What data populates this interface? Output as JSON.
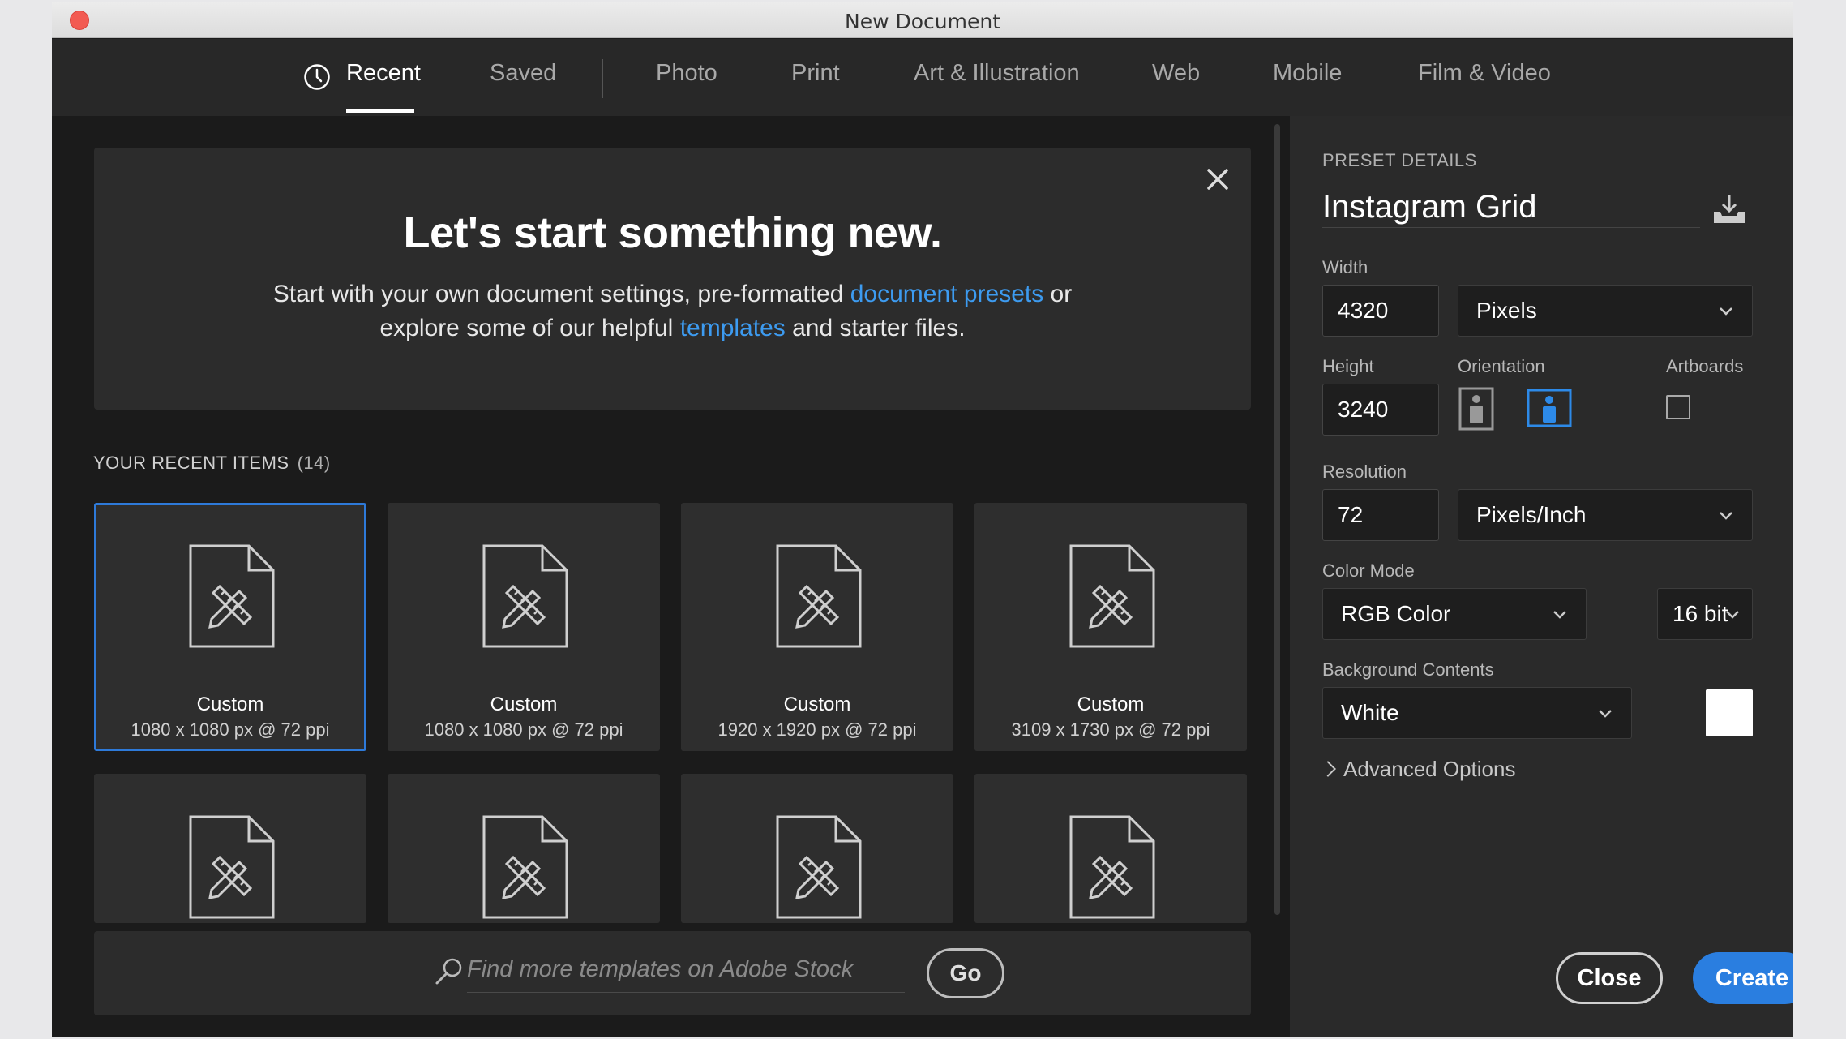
{
  "window": {
    "title": "New Document"
  },
  "tabs": [
    {
      "label": "Recent",
      "active": true
    },
    {
      "label": "Saved"
    },
    {
      "label": "Photo"
    },
    {
      "label": "Print"
    },
    {
      "label": "Art & Illustration"
    },
    {
      "label": "Web"
    },
    {
      "label": "Mobile"
    },
    {
      "label": "Film & Video"
    }
  ],
  "welcome": {
    "title": "Let's start something new.",
    "line1_pre": "Start with your own document settings, pre-formatted ",
    "line1_link": "document presets",
    "line1_post": " or",
    "line2_pre": "explore some of our helpful ",
    "line2_link": "templates",
    "line2_post": " and starter files."
  },
  "recent": {
    "header": "YOUR RECENT ITEMS",
    "count": "(14)",
    "items": [
      {
        "name": "Custom",
        "dims": "1080 x 1080 px @ 72 ppi"
      },
      {
        "name": "Custom",
        "dims": "1080 x 1080 px @ 72 ppi"
      },
      {
        "name": "Custom",
        "dims": "1920 x 1920 px @ 72 ppi"
      },
      {
        "name": "Custom",
        "dims": "3109 x 1730 px @ 72 ppi"
      }
    ]
  },
  "stock": {
    "placeholder": "Find more templates on Adobe Stock",
    "go_label": "Go"
  },
  "preset": {
    "heading": "PRESET DETAILS",
    "name": "Instagram Grid",
    "width_label": "Width",
    "width_value": "4320",
    "width_unit": "Pixels",
    "height_label": "Height",
    "height_value": "3240",
    "orientation_label": "Orientation",
    "artboards_label": "Artboards",
    "resolution_label": "Resolution",
    "resolution_value": "72",
    "resolution_unit": "Pixels/Inch",
    "color_mode_label": "Color Mode",
    "color_mode": "RGB Color",
    "bit_depth": "16 bit",
    "bg_label": "Background Contents",
    "bg_value": "White",
    "bg_color": "#ffffff",
    "advanced_label": "Advanced Options"
  },
  "actions": {
    "close_label": "Close",
    "create_label": "Create"
  },
  "colors": {
    "accent": "#2a7ee0",
    "link": "#3d9bf0",
    "selected_border": "#2e7ad9"
  }
}
